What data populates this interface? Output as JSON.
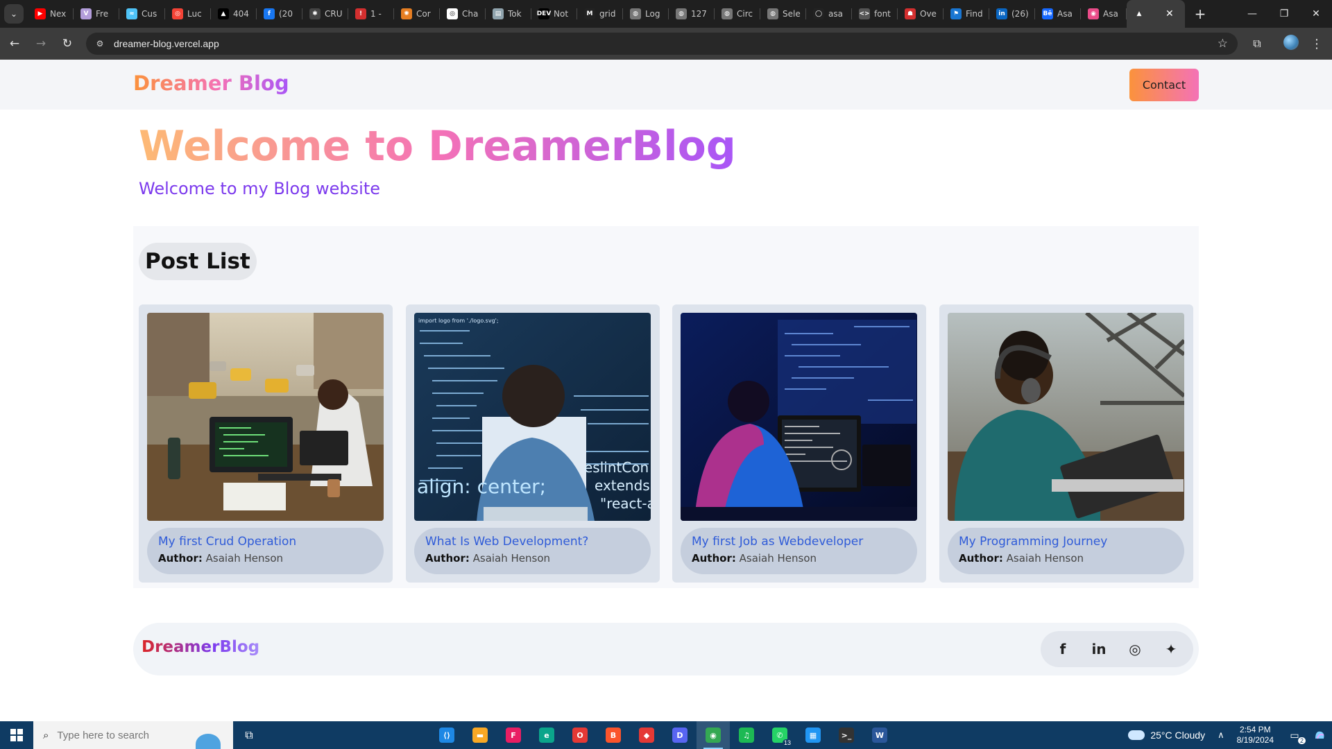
{
  "browser": {
    "tabs": [
      {
        "label": "Nex",
        "icon": "youtube-icon",
        "color": "#ff0000",
        "glyph": "▶"
      },
      {
        "label": "Fre",
        "icon": "vuetify-icon",
        "color": "#b39ddb",
        "glyph": "V"
      },
      {
        "label": "Cus",
        "icon": "wave-icon",
        "color": "#4fc3f7",
        "glyph": "≈"
      },
      {
        "label": "Luc",
        "icon": "lucide-icon",
        "color": "#f44336",
        "glyph": "◎"
      },
      {
        "label": "404",
        "icon": "vercel-icon",
        "color": "#000000",
        "glyph": "▲"
      },
      {
        "label": "(20",
        "icon": "facebook-icon",
        "color": "#1877f2",
        "glyph": "f"
      },
      {
        "label": "CRU",
        "icon": "spark-icon",
        "color": "#444444",
        "glyph": "✱"
      },
      {
        "label": "1 - ",
        "icon": "shield-icon",
        "color": "#d32f2f",
        "glyph": "!"
      },
      {
        "label": "Cor",
        "icon": "claude-icon",
        "color": "#e67e22",
        "glyph": "✺"
      },
      {
        "label": "Cha",
        "icon": "chatgpt-icon",
        "color": "#ffffff",
        "glyph": "◎"
      },
      {
        "label": "Tok",
        "icon": "book-icon",
        "color": "#90a4ae",
        "glyph": "▤"
      },
      {
        "label": "Not",
        "icon": "dev-icon",
        "color": "#000000",
        "glyph": "DEV"
      },
      {
        "label": "grid",
        "icon": "medium-icon",
        "color": "#222222",
        "glyph": "M"
      },
      {
        "label": "Log",
        "icon": "globe-icon",
        "color": "#777777",
        "glyph": "◍"
      },
      {
        "label": "127",
        "icon": "globe-icon",
        "color": "#777777",
        "glyph": "◍"
      },
      {
        "label": "Circ",
        "icon": "globe-icon",
        "color": "#777777",
        "glyph": "◍"
      },
      {
        "label": "Sele",
        "icon": "globe-icon",
        "color": "#777777",
        "glyph": "◍"
      },
      {
        "label": "asa",
        "icon": "github-icon",
        "color": "#222222",
        "glyph": "◯"
      },
      {
        "label": "font",
        "icon": "code-icon",
        "color": "#555555",
        "glyph": "<>"
      },
      {
        "label": "Ove",
        "icon": "bug-icon",
        "color": "#d32f2f",
        "glyph": "☗"
      },
      {
        "label": "Find",
        "icon": "flag-icon",
        "color": "#1976d2",
        "glyph": "⚑"
      },
      {
        "label": "(26)",
        "icon": "linkedin-icon",
        "color": "#0a66c2",
        "glyph": "in"
      },
      {
        "label": "Asa",
        "icon": "behance-icon",
        "color": "#1769ff",
        "glyph": "Bē"
      },
      {
        "label": "Asa",
        "icon": "dribbble-icon",
        "color": "#ea4c89",
        "glyph": "◉"
      }
    ],
    "active_tab": {
      "label": "",
      "icon": "vercel-icon",
      "glyph": "▲"
    },
    "url": "dreamer-blog.vercel.app"
  },
  "site": {
    "brand": "Dreamer Blog",
    "contact_label": "Contact",
    "hero_title": "Welcome to DreamerBlog",
    "hero_subtitle": "Welcome to my Blog website",
    "section_title": "Post List",
    "author_label": "Author:",
    "posts": [
      {
        "title": "My first Crud Operation",
        "author": "Asaiah Henson",
        "image": "developer-on-street-photo"
      },
      {
        "title": "What Is Web Development?",
        "author": "Asaiah Henson",
        "image": "code-screen-photo"
      },
      {
        "title": "My first Job as Webdeveloper",
        "author": "Asaiah Henson",
        "image": "night-desk-photo"
      },
      {
        "title": "My Programming Journey",
        "author": "Asaiah Henson",
        "image": "bridge-laptop-photo"
      }
    ],
    "footer_brand": "DreamerBlog",
    "socials": [
      {
        "name": "facebook-icon",
        "glyph": "f"
      },
      {
        "name": "linkedin-icon",
        "glyph": "in"
      },
      {
        "name": "instagram-icon",
        "glyph": "◎"
      },
      {
        "name": "twitter-icon",
        "glyph": "✦"
      }
    ],
    "snippets": {
      "code": "import logo from './logo.svg';",
      "align": "align: center;",
      "eslint": "eslintCon",
      "extends": "extends",
      "react": "\"react-a"
    }
  },
  "taskbar": {
    "search_placeholder": "Type here to search",
    "apps": [
      {
        "name": "vscode-icon",
        "glyph": "⟨⟩",
        "color": "#1e88e5"
      },
      {
        "name": "file-explorer-icon",
        "glyph": "▬",
        "color": "#f9a825"
      },
      {
        "name": "figma-icon",
        "glyph": "F",
        "color": "#e91e63"
      },
      {
        "name": "edge-icon",
        "glyph": "e",
        "color": "#0ba58b"
      },
      {
        "name": "opera-icon",
        "glyph": "O",
        "color": "#e53935"
      },
      {
        "name": "brave-icon",
        "glyph": "B",
        "color": "#fb542b"
      },
      {
        "name": "shield-app-icon",
        "glyph": "◆",
        "color": "#e53935"
      },
      {
        "name": "discord-icon",
        "glyph": "D",
        "color": "#5865f2"
      },
      {
        "name": "chrome-icon",
        "glyph": "◉",
        "color": "#34a853"
      },
      {
        "name": "spotify-icon",
        "glyph": "♫",
        "color": "#1db954"
      },
      {
        "name": "whatsapp-icon",
        "glyph": "✆",
        "color": "#25d366",
        "badge": "13"
      },
      {
        "name": "store-icon",
        "glyph": "▦",
        "color": "#2196f3"
      },
      {
        "name": "terminal-icon",
        "glyph": ">_",
        "color": "#333333"
      },
      {
        "name": "word-icon",
        "glyph": "W",
        "color": "#2b579a"
      }
    ],
    "active_app_index": 8,
    "weather": "25°C  Cloudy",
    "time": "2:54 PM",
    "date": "8/19/2024",
    "notification_count": "2"
  }
}
